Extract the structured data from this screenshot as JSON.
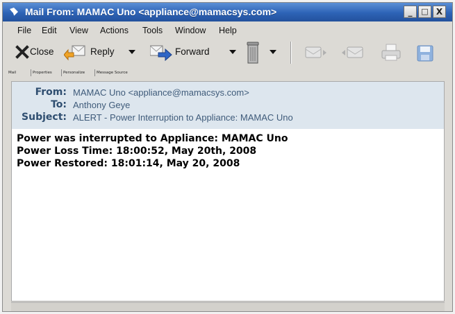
{
  "window": {
    "title": "Mail From: MAMAC Uno <appliance@mamacsys.com>",
    "controls": {
      "minimize": "_",
      "maximize": "□",
      "close": "X"
    }
  },
  "menu": [
    "File",
    "Edit",
    "View",
    "Actions",
    "Tools",
    "Window",
    "Help"
  ],
  "toolbar": {
    "close_label": "Close",
    "reply_label": "Reply",
    "forward_label": "Forward"
  },
  "tabs": [
    "Mail",
    "Properties",
    "Personalize",
    "Message Source"
  ],
  "message": {
    "from_label": "From:",
    "from_value": "MAMAC Uno <appliance@mamacsys.com>",
    "to_label": "To:",
    "to_value": "Anthony Geye",
    "subject_label": "Subject:",
    "subject_value": "ALERT - Power Interruption to Appliance: MAMAC Uno",
    "body": [
      "Power was interrupted to Appliance: MAMAC Uno",
      "Power Loss Time: 18:00:52, May 20th, 2008",
      "Power Restored: 18:01:14, May 20, 2008"
    ]
  },
  "colors": {
    "titlebar": "#2d63b6",
    "header_bg": "#dde6ee",
    "header_text": "#3f5b7a"
  }
}
